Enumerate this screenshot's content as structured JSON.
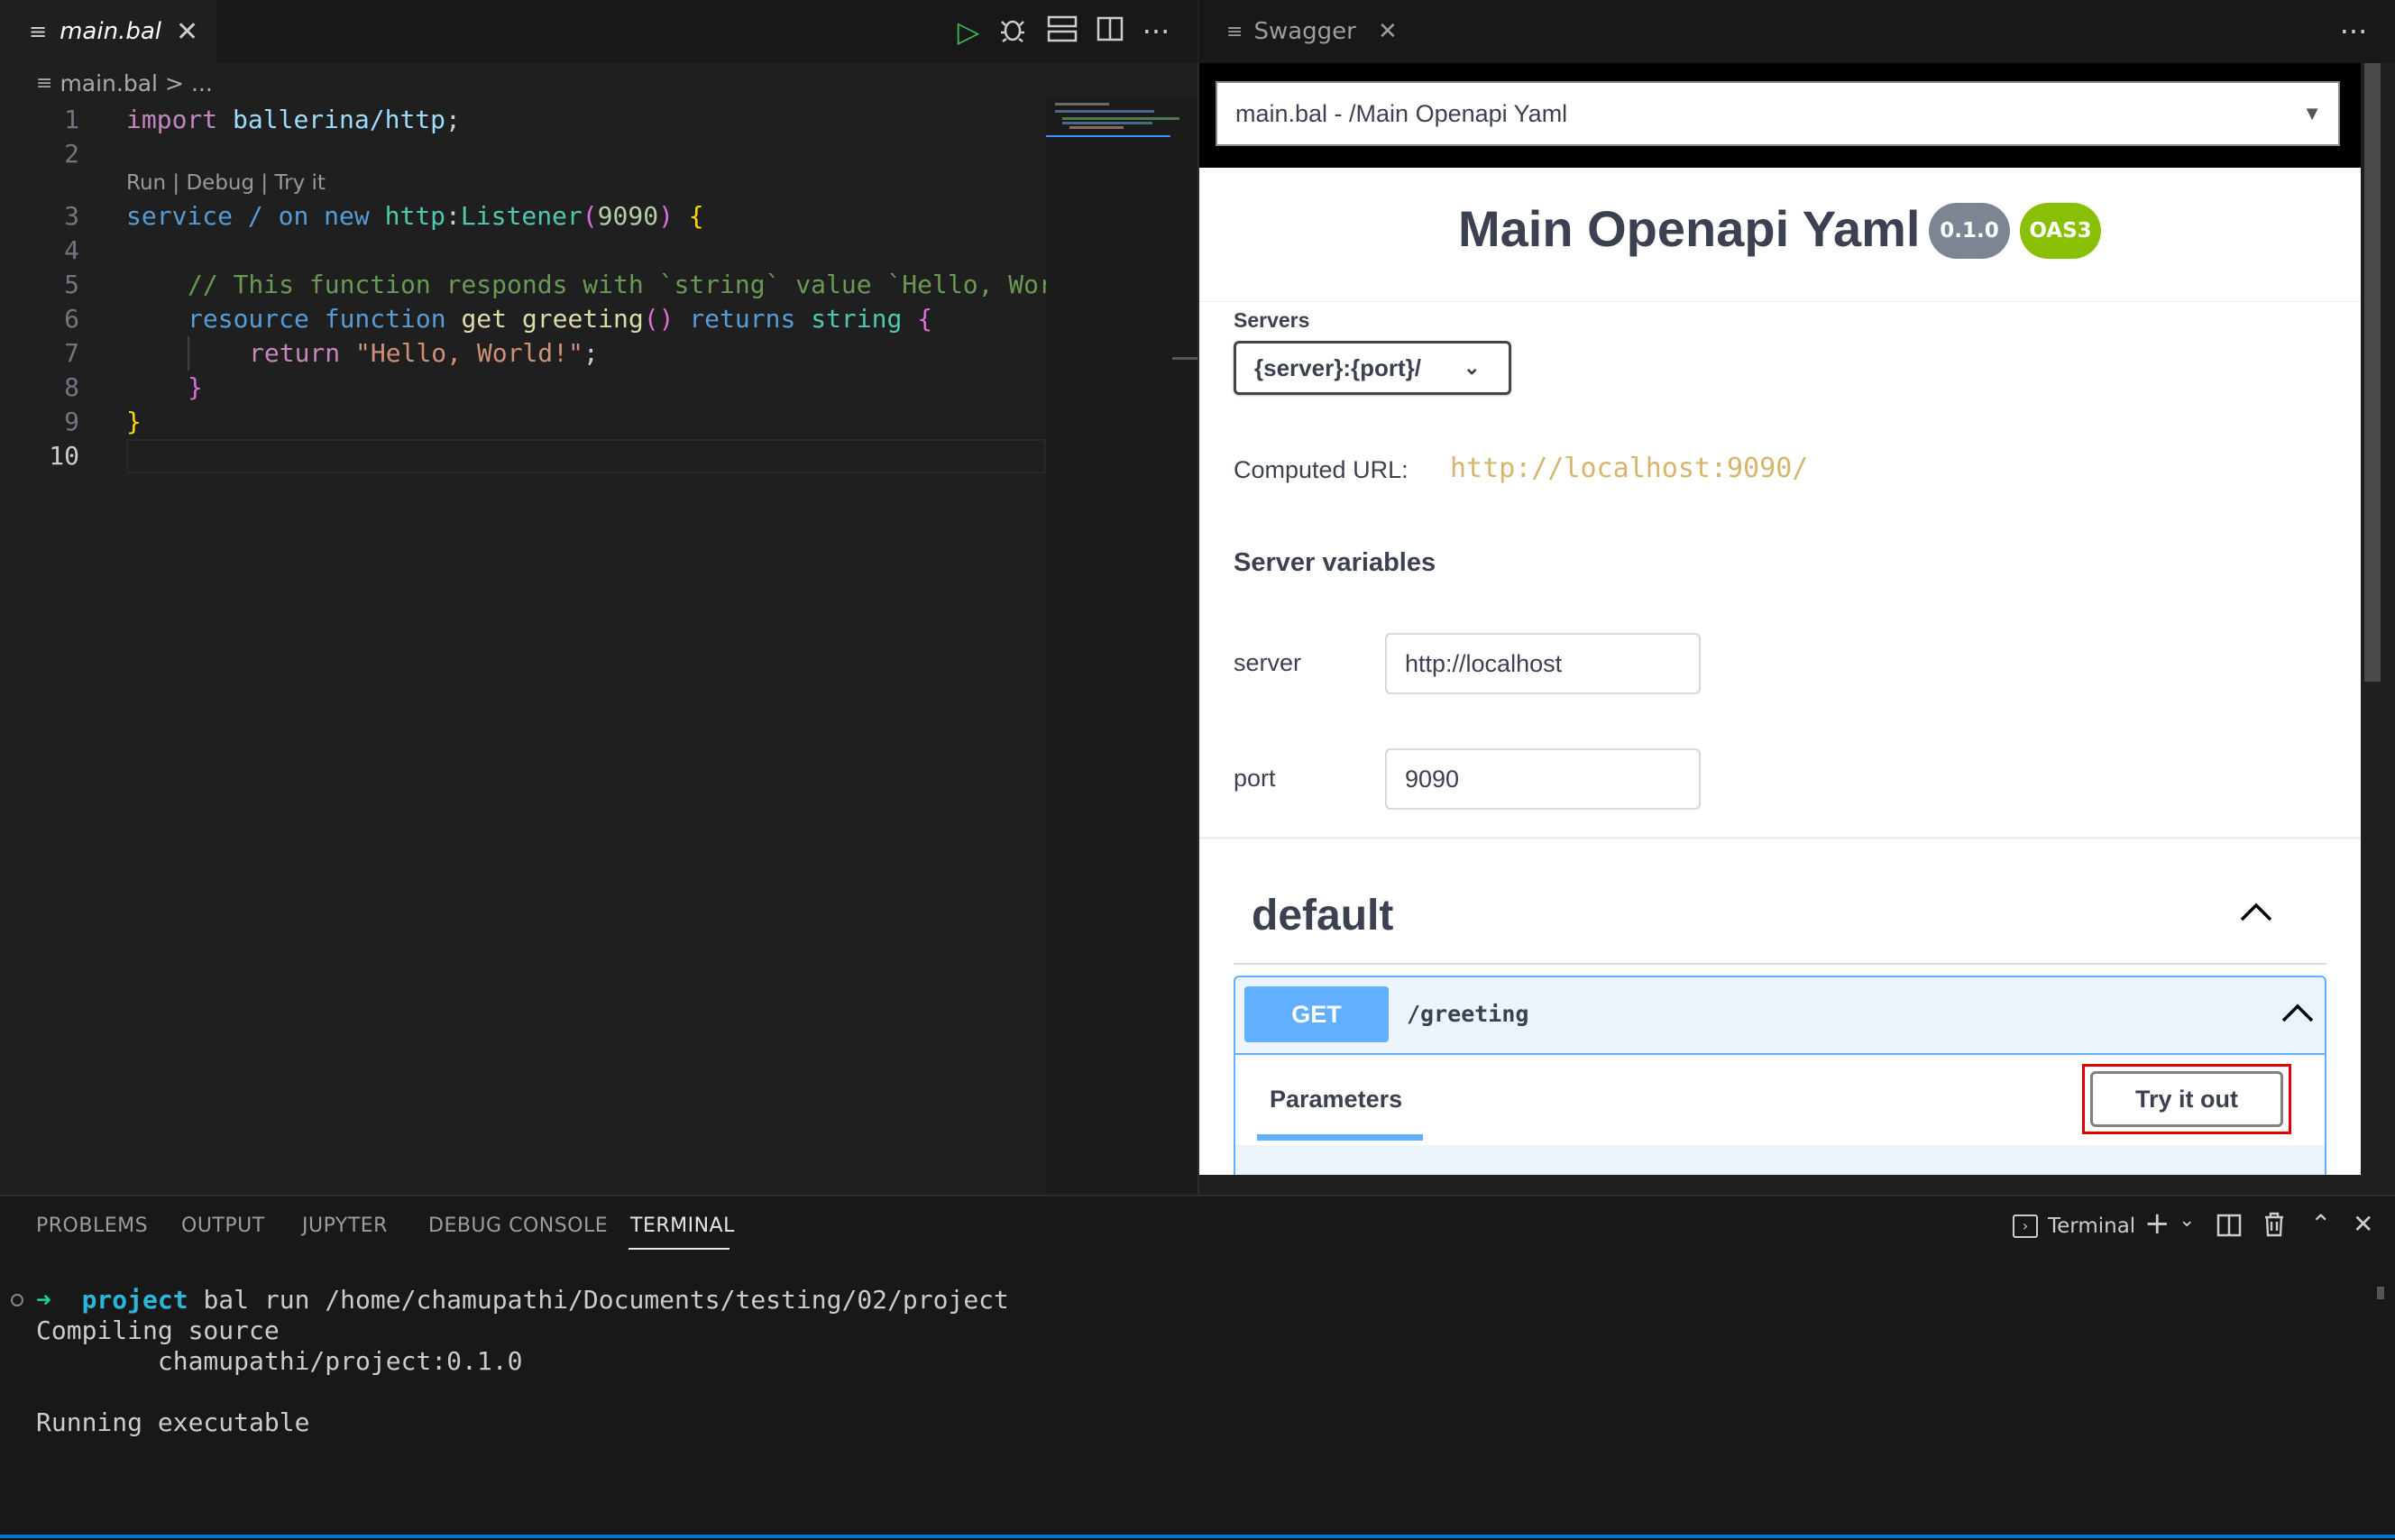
{
  "editor": {
    "tab": {
      "filename": "main.bal",
      "icon": "file-lines-icon"
    },
    "breadcrumb": {
      "file": "main.bal",
      "separator": ">",
      "rest": "..."
    },
    "codelens": "Run | Debug | Try it",
    "line_numbers": [
      "1",
      "2",
      "3",
      "4",
      "5",
      "6",
      "7",
      "8",
      "9",
      "10"
    ],
    "code": {
      "l1_import": "import",
      "l1_module": "ballerina/http",
      "l1_semi": ";",
      "l3_service": "service",
      "l3_path": "/",
      "l3_on": "on",
      "l3_new": "new",
      "l3_http": "http",
      "l3_colon": ":",
      "l3_listener": "Listener",
      "l3_open": "(",
      "l3_port": "9090",
      "l3_close": ")",
      "l3_brace": "{",
      "l5_comment": "// This function responds with `string` value `Hello, Wor",
      "l6_resource": "resource",
      "l6_function": "function",
      "l6_get": "get",
      "l6_name": "greeting",
      "l6_parens": "()",
      "l6_returns": "returns",
      "l6_string": "string",
      "l6_brace": "{",
      "l7_return": "return",
      "l7_value": "\"Hello, World!\"",
      "l7_semi": ";",
      "l8_brace": "}",
      "l9_brace": "}"
    }
  },
  "swagger": {
    "tab_label": "Swagger",
    "spec_selector": "main.bal - /Main Openapi Yaml",
    "title": "Main Openapi Yaml",
    "version_badge": "0.1.0",
    "oas_badge": "OAS3",
    "servers_label": "Servers",
    "servers_selected": "{server}:{port}/",
    "computed_url_label": "Computed URL:",
    "computed_url": "http://localhost:9090/",
    "server_variables_heading": "Server variables",
    "variables": [
      {
        "name": "server",
        "value": "http://localhost"
      },
      {
        "name": "port",
        "value": "9090"
      }
    ],
    "section_title": "default",
    "operation": {
      "method": "GET",
      "path": "/greeting"
    },
    "parameters_label": "Parameters",
    "try_button": "Try it out",
    "colors": {
      "get_method": "#61affe",
      "version_badge": "#7d8492",
      "oas_badge": "#89bf04",
      "highlight": "#e00000"
    }
  },
  "panel": {
    "tabs": [
      "PROBLEMS",
      "OUTPUT",
      "JUPYTER",
      "DEBUG CONSOLE",
      "TERMINAL"
    ],
    "active_tab": "TERMINAL",
    "terminal_label": "Terminal",
    "terminal": {
      "prompt_arrow": "➜",
      "project": "project",
      "command": "bal run /home/chamupathi/Documents/testing/02/project",
      "line2": "Compiling source",
      "line3": "        chamupathi/project:0.1.0",
      "line4": "Running executable"
    }
  }
}
